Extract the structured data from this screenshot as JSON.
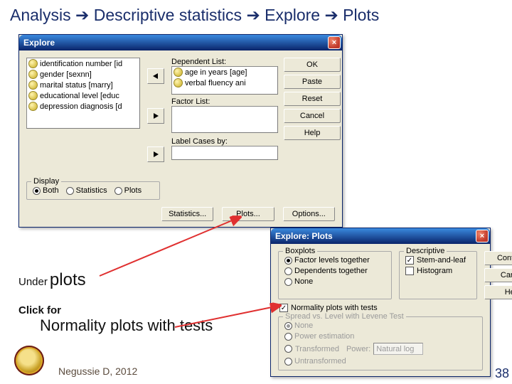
{
  "slide": {
    "breadcrumb_parts": [
      "Analysis",
      "Descriptive statistics",
      "Explore",
      "Plots"
    ],
    "arrow_glyph": "➔",
    "under_label": "Under",
    "under_word": "plots",
    "click_for": "Click for",
    "normality_title": "Normality plots with tests",
    "author": "Negussie D, 2012",
    "page": "38"
  },
  "explore": {
    "title": "Explore",
    "source_vars": [
      "identification number [id",
      "gender [sexnn]",
      "marital status [marry]",
      "educational level [educ",
      "depression diagnosis [d"
    ],
    "dependent_label": "Dependent List:",
    "dependent_vars": [
      "age in years [age]",
      "verbal fluency   ani"
    ],
    "factor_label": "Factor List:",
    "labelcases_label": "Label Cases by:",
    "buttons": {
      "ok": "OK",
      "paste": "Paste",
      "reset": "Reset",
      "cancel": "Cancel",
      "help": "Help"
    },
    "display_legend": "Display",
    "display_opts": [
      "Both",
      "Statistics",
      "Plots"
    ],
    "bottom_buttons": [
      "Statistics...",
      "Plots...",
      "Options..."
    ]
  },
  "plots": {
    "title": "Explore: Plots",
    "buttons": {
      "continue": "Continue",
      "cancel": "Cancel",
      "help": "Help"
    },
    "boxplots_legend": "Boxplots",
    "boxplots_opts": [
      "Factor levels together",
      "Dependents together",
      "None"
    ],
    "descriptive_legend": "Descriptive",
    "descriptive_opts": [
      "Stem-and-leaf",
      "Histogram"
    ],
    "normality_check": "Normality plots with tests",
    "spread_legend": "Spread vs. Level with Levene Test",
    "spread_opts": [
      "None",
      "Power estimation",
      "Transformed",
      "Untransformed"
    ],
    "power_label": "Power:",
    "power_value": "Natural log"
  }
}
